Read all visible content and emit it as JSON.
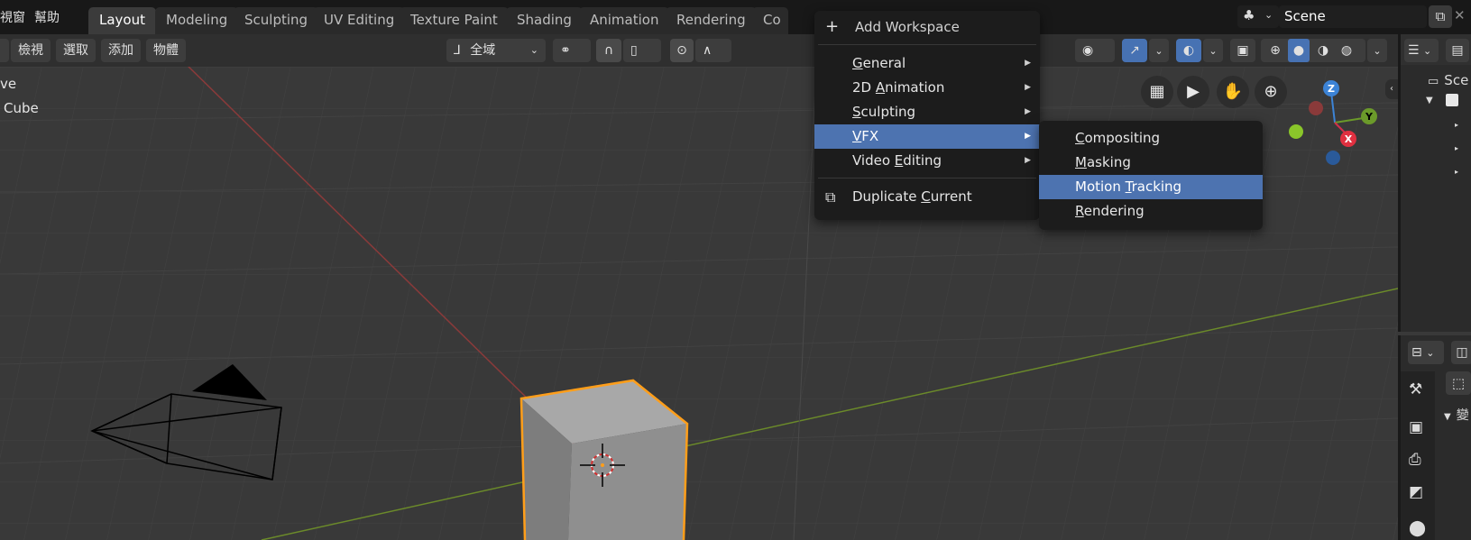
{
  "menubar": {
    "items": [
      "視窗",
      "幫助"
    ]
  },
  "workspace_tabs": [
    "Layout",
    "Modeling",
    "Sculpting",
    "UV Editing",
    "Texture Paint",
    "Shading",
    "Animation",
    "Rendering",
    "Co"
  ],
  "active_tab": "Layout",
  "scene": {
    "name": "Scene"
  },
  "viewport_header": {
    "menus": [
      "檢視",
      "選取",
      "添加",
      "物體"
    ],
    "transform_orientation": "全域"
  },
  "viewport": {
    "overlay_line1": "ve",
    "overlay_line2": "Cube"
  },
  "outliner": {
    "scene_label": "Sce"
  },
  "properties": {
    "section_label": "變"
  },
  "workspace_menu": {
    "header": "Add Workspace",
    "items": [
      {
        "label": "General",
        "underline": "G",
        "rest": "eneral"
      },
      {
        "label": "2D Animation",
        "pre": "2D ",
        "underline": "A",
        "rest": "nimation"
      },
      {
        "label": "Sculpting",
        "underline": "S",
        "rest": "culpting"
      },
      {
        "label": "VFX",
        "underline": "V",
        "rest": "FX",
        "highlighted": true
      },
      {
        "label": "Video Editing",
        "pre": "Video ",
        "underline": "E",
        "rest": "diting"
      }
    ],
    "footer": {
      "pre": "Duplicate ",
      "underline": "C",
      "rest": "urrent"
    }
  },
  "vfx_submenu": {
    "items": [
      {
        "underline": "C",
        "rest": "ompositing"
      },
      {
        "underline": "M",
        "rest": "asking"
      },
      {
        "pre": "Motion ",
        "underline": "T",
        "rest": "racking",
        "highlighted": true
      },
      {
        "underline": "R",
        "rest": "endering"
      }
    ]
  },
  "gizmo": {
    "z": "Z",
    "y": "Y",
    "x": "X"
  },
  "colors": {
    "accent": "#4772b3",
    "highlight": "#4d73b0",
    "selection": "#ff9e1a"
  }
}
